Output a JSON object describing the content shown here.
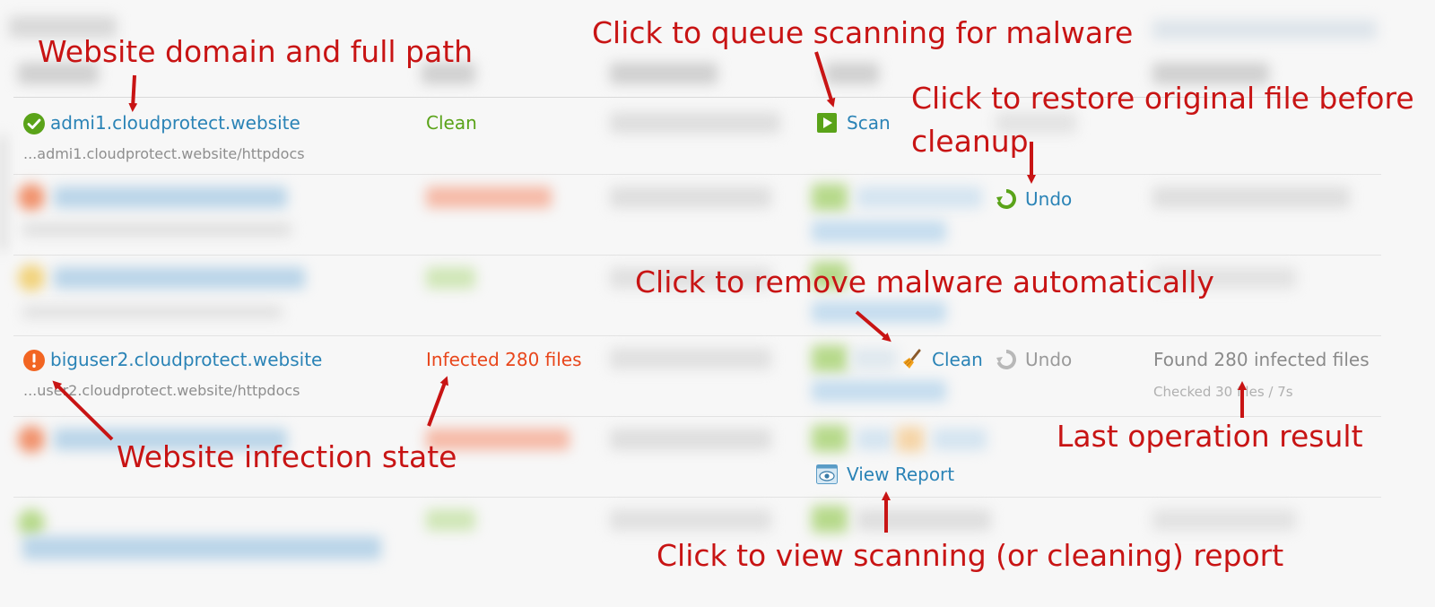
{
  "rows": [
    {
      "domain": "admi1.cloudprotect.website",
      "path": "...admi1.cloudprotect.website/httpdocs",
      "state": "Clean",
      "action": "Scan"
    },
    {
      "undo_label": "Undo"
    },
    {
      "domain": "biguser2.cloudprotect.website",
      "path": "...user2.cloudprotect.website/httpdocs",
      "state": "Infected 280 files",
      "clean_action": "Clean",
      "undo_label": "Undo",
      "result": "Found 280 infected files",
      "result_detail": "Checked 30 files / 7s"
    },
    {
      "report_action": "View Report"
    }
  ],
  "annotations": {
    "domain_path": "Website domain and full path",
    "queue_scan": "Click to queue scanning for malware",
    "restore_line1": "Click to restore original file before",
    "restore_line2": "cleanup",
    "remove_malware": "Click to remove malware automatically",
    "infection_state": "Website infection state",
    "last_result": "Last operation result",
    "view_report": "Click to view scanning (or cleaning) report"
  },
  "colors": {
    "link": "#2a83b6",
    "clean": "#5aa319",
    "infected": "#e8461b",
    "annotation": "#c81414"
  },
  "icons": [
    "check-circle-icon",
    "exclamation-circle-icon",
    "play-icon",
    "undo-icon",
    "broom-icon",
    "eye-icon"
  ]
}
